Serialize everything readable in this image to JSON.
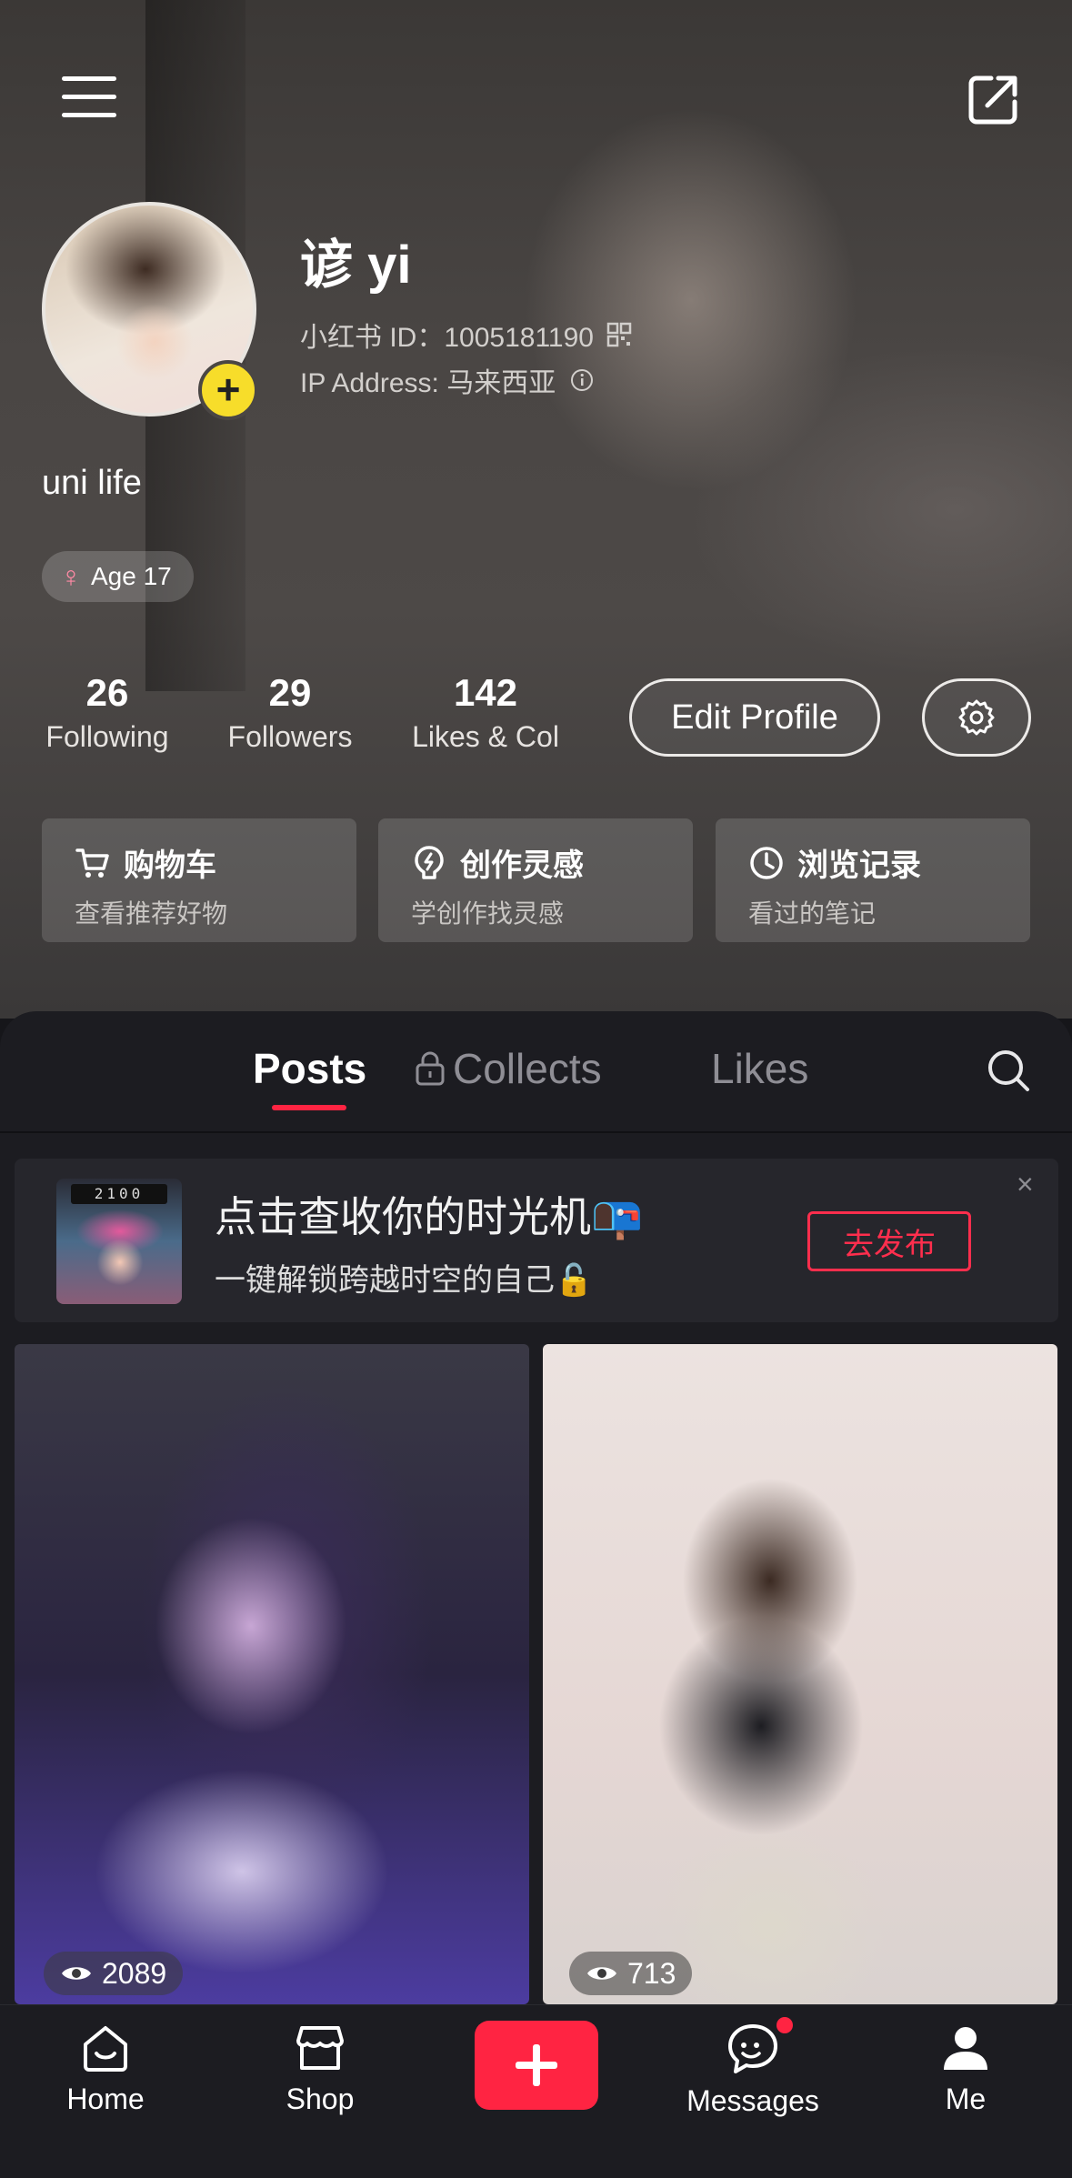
{
  "profile": {
    "name": "谚 yi",
    "id_line": "小红书 ID：1005181190",
    "ip_line": "IP Address: 马来西亚",
    "bio": "uni life",
    "tag": "Age 17"
  },
  "stats": [
    {
      "num": "26",
      "label": "Following"
    },
    {
      "num": "29",
      "label": "Followers"
    },
    {
      "num": "142",
      "label": "Likes & Col"
    }
  ],
  "actions": {
    "edit_profile": "Edit Profile"
  },
  "cards": [
    {
      "title": "购物车",
      "sub": "查看推荐好物",
      "icon": "cart-icon"
    },
    {
      "title": "创作灵感",
      "sub": "学创作找灵感",
      "icon": "bulb-icon"
    },
    {
      "title": "浏览记录",
      "sub": "看过的笔记",
      "icon": "clock-icon"
    }
  ],
  "tabs": {
    "posts": "Posts",
    "collects": "Collects",
    "likes": "Likes"
  },
  "banner": {
    "timer": "2100",
    "title": "点击查收你的时光机📭",
    "subtitle": "一键解锁跨越时空的自己🔓",
    "button": "去发布",
    "close": "×"
  },
  "posts": [
    {
      "views": "2089"
    },
    {
      "views": "713"
    }
  ],
  "nav": {
    "home": "Home",
    "shop": "Shop",
    "messages": "Messages",
    "me": "Me"
  },
  "colors": {
    "accent": "#ff2442",
    "avatar_plus": "#f7dd2a"
  }
}
